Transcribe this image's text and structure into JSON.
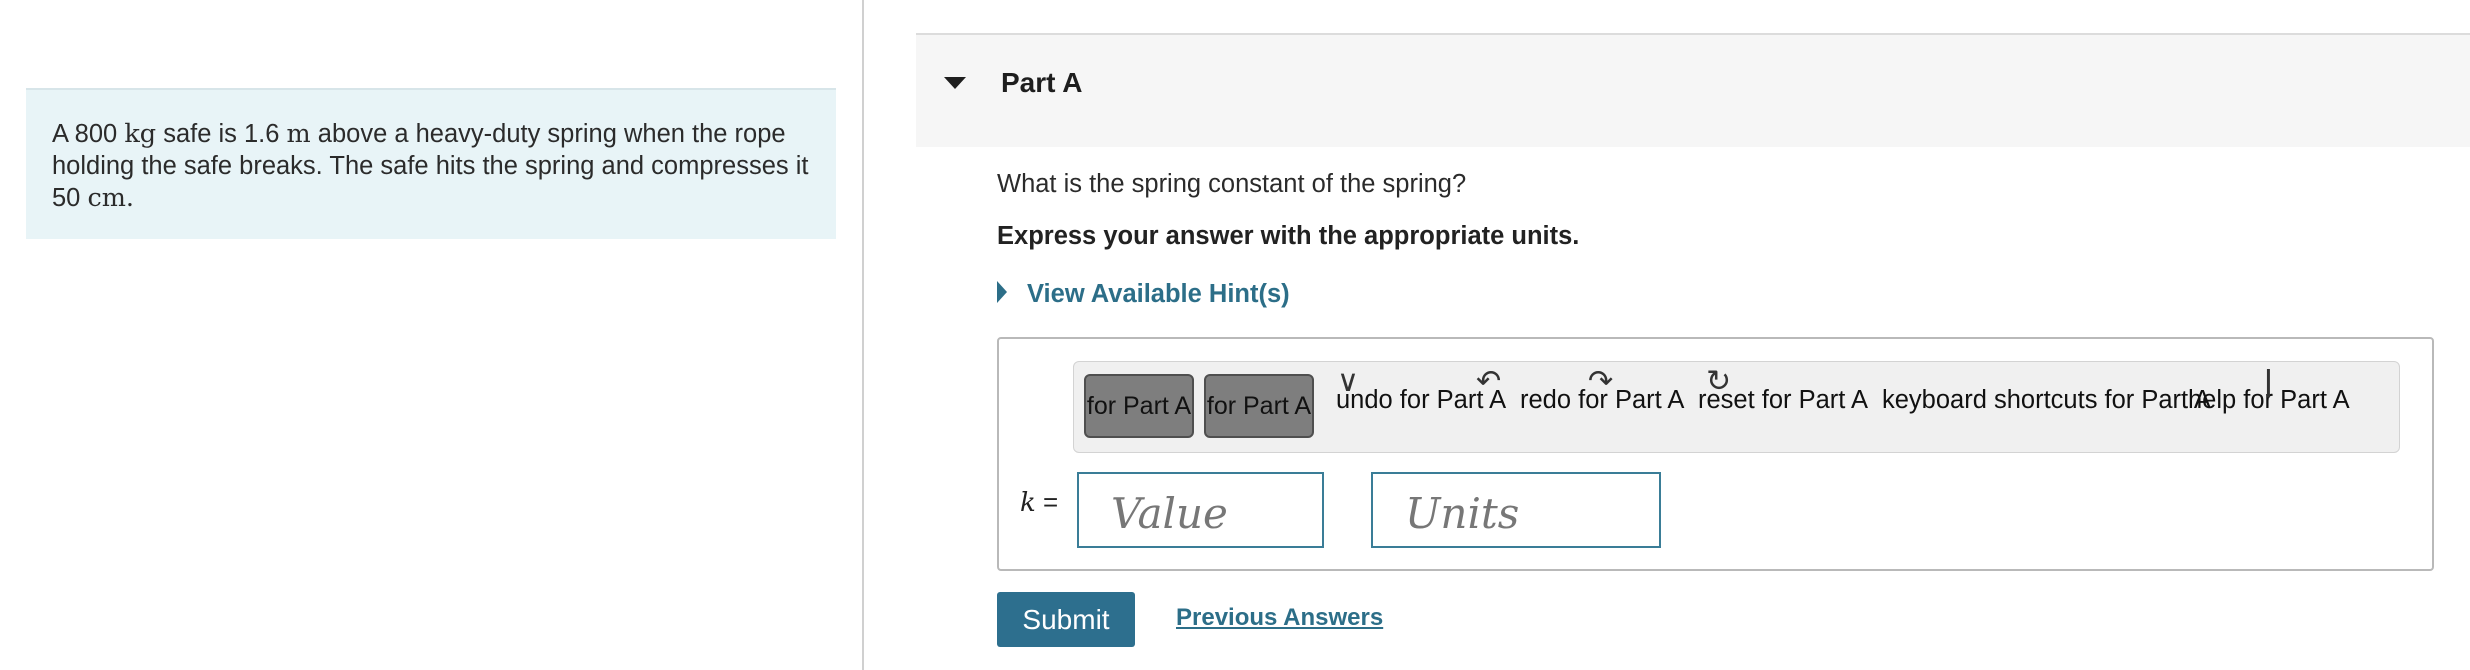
{
  "problem": {
    "text_1": "A 800 ",
    "mass_unit": "kg",
    "text_2": " safe is 1.6 ",
    "height_unit": "m",
    "text_3": " above a heavy-duty spring when the rope holding the safe breaks. The safe hits the spring and compresses it 50 ",
    "compression_unit": "cm",
    "text_4": "."
  },
  "part": {
    "title": "Part A",
    "question": "What is the spring constant of the spring?",
    "instruction": "Express your answer with the appropriate units.",
    "hint_label": "View Available Hint(s)"
  },
  "toolbar": {
    "button_1_label": "for Part A",
    "button_2_label": "for Part A",
    "undo_label": "undo for Part A",
    "redo_label": "redo for Part A",
    "reset_label": "reset for Part A",
    "shortcuts_label": "keyboard shortcuts for Part A",
    "help_label": "help for Part A"
  },
  "answer": {
    "variable": "k",
    "equals": "=",
    "value_placeholder": "Value",
    "units_placeholder": "Units",
    "value": "",
    "units": ""
  },
  "actions": {
    "submit_label": "Submit",
    "previous_answers_label": "Previous Answers"
  },
  "colors": {
    "accent": "#2d6f8e",
    "problem_background": "#e8f4f7",
    "toolbar_button": "#7e7e7e"
  }
}
